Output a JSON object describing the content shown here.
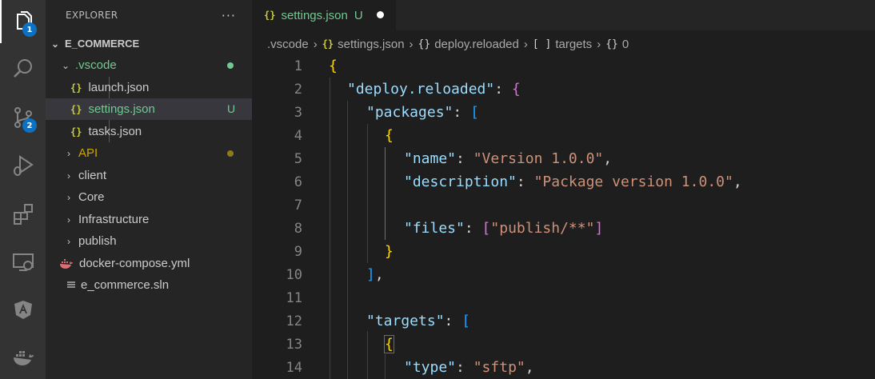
{
  "activity_bar": {
    "explorer_badge": "1",
    "scm_badge": "2"
  },
  "explorer": {
    "title": "EXPLORER",
    "more": "···",
    "root": "E_COMMERCE",
    "items": [
      {
        "label": ".vscode",
        "chevron": "⌄",
        "color": "#73c991"
      },
      {
        "label": "launch.json"
      },
      {
        "label": "settings.json",
        "status": "U"
      },
      {
        "label": "tasks.json"
      },
      {
        "label": "API",
        "chevron": "›",
        "color": "#cca700"
      },
      {
        "label": "client",
        "chevron": "›"
      },
      {
        "label": "Core",
        "chevron": "›"
      },
      {
        "label": "Infrastructure",
        "chevron": "›"
      },
      {
        "label": "publish",
        "chevron": "›"
      },
      {
        "label": "docker-compose.yml"
      },
      {
        "label": "e_commerce.sln"
      }
    ]
  },
  "tab": {
    "icon": "{}",
    "label": "settings.json",
    "status": "U"
  },
  "breadcrumb": {
    "folder": ".vscode",
    "file": "settings.json",
    "obj1": "deploy.reloaded",
    "arr": "targets",
    "obj2": "0",
    "obj_icon": "{}",
    "arr_icon": "[ ]",
    "sep": "›"
  },
  "code": {
    "line_numbers": [
      "1",
      "2",
      "3",
      "4",
      "5",
      "6",
      "7",
      "8",
      "9",
      "10",
      "11",
      "12",
      "13",
      "14"
    ],
    "l1_open": "{",
    "l2_key": "\"deploy.reloaded\"",
    "l2_colon": ": ",
    "l2_open": "{",
    "l3_key": "\"packages\"",
    "l3_colon": ": ",
    "l3_open": "[",
    "l4_open": "{",
    "l5_key": "\"name\"",
    "l5_colon": ": ",
    "l5_val": "\"Version 1.0.0\"",
    "l5_comma": ",",
    "l6_key": "\"description\"",
    "l6_colon": ": ",
    "l6_val": "\"Package version 1.0.0\"",
    "l6_comma": ",",
    "l8_key": "\"files\"",
    "l8_colon": ": ",
    "l8_open": "[",
    "l8_val": "\"publish/**\"",
    "l8_close": "]",
    "l9_close": "}",
    "l10_close": "]",
    "l10_comma": ",",
    "l12_key": "\"targets\"",
    "l12_colon": ": ",
    "l12_open": "[",
    "l13_open": "{",
    "l14_key": "\"type\"",
    "l14_colon": ": ",
    "l14_val": "\"sftp\"",
    "l14_comma": ","
  }
}
